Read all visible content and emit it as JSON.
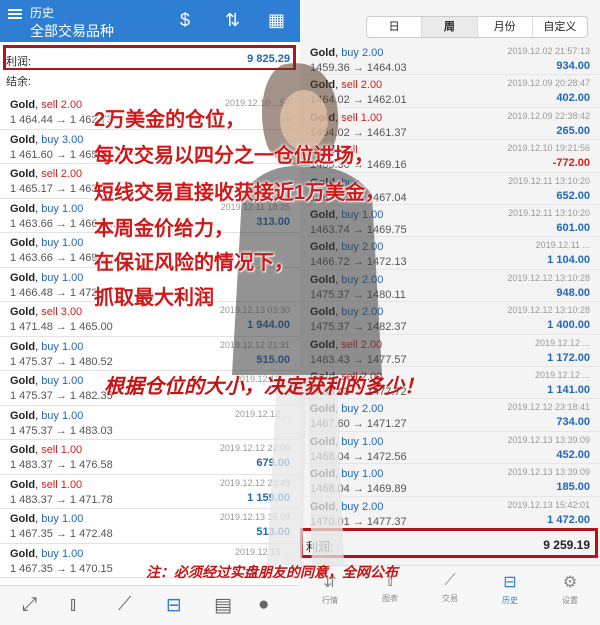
{
  "left": {
    "header": {
      "title": "历史",
      "subtitle": "全部交易品种"
    },
    "summary": {
      "profit_label": "利润:",
      "profit_value": "9 825.29",
      "balance_label": "结余:"
    },
    "trades": [
      {
        "symbol": "Gold",
        "side": "sell",
        "lots": "2.00",
        "prices": "1 464.44 → 1 462.73",
        "datetime": "2019.12.10 ...52",
        "profit": "..."
      },
      {
        "symbol": "Gold",
        "side": "buy",
        "lots": "3.00",
        "prices": "1 461.60 → 1 465.1...",
        "datetime": "",
        "profit": ""
      },
      {
        "symbol": "Gold",
        "side": "sell",
        "lots": "2.00",
        "prices": "1 465.17 → 1 463.64",
        "datetime": "",
        "profit": ""
      },
      {
        "symbol": "Gold",
        "side": "buy",
        "lots": "1.00",
        "prices": "1 463.66 → 1 466.7...",
        "datetime": "2019.12.11 18:25",
        "profit": "313.00"
      },
      {
        "symbol": "Gold",
        "side": "buy",
        "lots": "1.00",
        "prices": "1 463.66 → 1 469.6...",
        "datetime": "",
        "profit": ""
      },
      {
        "symbol": "Gold",
        "side": "buy",
        "lots": "1.00",
        "prices": "1 466.48 → 1 472.00",
        "datetime": "",
        "profit": ""
      },
      {
        "symbol": "Gold",
        "side": "sell",
        "lots": "3.00",
        "prices": "1 471.48 → 1 465.00",
        "datetime": "2019.12.13 03:30",
        "profit": "1 944.00"
      },
      {
        "symbol": "Gold",
        "side": "buy",
        "lots": "1.00",
        "prices": "1 475.37 → 1 480.52",
        "datetime": "2019.12.12 21:31",
        "profit": "515.00"
      },
      {
        "symbol": "Gold",
        "side": "buy",
        "lots": "1.00",
        "prices": "1 475.37 → 1 482.35",
        "datetime": "2019.12.12 ...",
        "profit": ""
      },
      {
        "symbol": "Gold",
        "side": "buy",
        "lots": "1.00",
        "prices": "1 475.37 → 1 483.03",
        "datetime": "2019.12.12 ...",
        "profit": ""
      },
      {
        "symbol": "Gold",
        "side": "sell",
        "lots": "1.00",
        "prices": "1 483.37 → 1 476.58",
        "datetime": "2019.12.12 22:00",
        "profit": "679.00"
      },
      {
        "symbol": "Gold",
        "side": "sell",
        "lots": "1.00",
        "prices": "1 483.37 → 1 471.78",
        "datetime": "2019.12.12 23:49",
        "profit": "1 159.00"
      },
      {
        "symbol": "Gold",
        "side": "buy",
        "lots": "1.00",
        "prices": "1 467.35 → 1 472.48",
        "datetime": "2019.12.13 16:09",
        "profit": "513.00"
      },
      {
        "symbol": "Gold",
        "side": "buy",
        "lots": "1.00",
        "prices": "1 467.35 → 1 470.15",
        "datetime": "2019.12.13 ...",
        "profit": ""
      }
    ],
    "tabs": [
      {
        "icon": "trend-arrow-icon"
      },
      {
        "icon": "candlestick-icon"
      },
      {
        "icon": "chart-line-icon"
      },
      {
        "icon": "inbox-icon"
      },
      {
        "icon": "news-icon"
      },
      {
        "icon": "chat-icon"
      }
    ]
  },
  "right": {
    "periods": [
      "日",
      "周",
      "月份",
      "自定义"
    ],
    "active_period": "周",
    "trades": [
      {
        "symbol": "Gold",
        "side": "buy",
        "lots": "2.00",
        "prices": "1459.36 → 1464.03",
        "datetime": "2019.12.02 21:57:13",
        "profit": "934.00"
      },
      {
        "symbol": "Gold",
        "side": "sell",
        "lots": "2.00",
        "prices": "1464.02 → 1462.01",
        "datetime": "2019.12.09 20:28:47",
        "profit": "402.00"
      },
      {
        "symbol": "Gold",
        "side": "sell",
        "lots": "1.00",
        "prices": "1464.02 → 1461.37",
        "datetime": "2019.12.09 22:38:42",
        "profit": "265.00"
      },
      {
        "symbol": "Gold",
        "side": "sell",
        "lots": "",
        "prices": "1465.30 → 1469.16",
        "datetime": "2019.12.10 19:21:56",
        "profit": "-772.00"
      },
      {
        "symbol": "Gold",
        "side": "buy",
        "lots": "",
        "prices": "1463.78 → 1467.04",
        "datetime": "2019.12.11 13:10:20",
        "profit": "652.00"
      },
      {
        "symbol": "Gold",
        "side": "buy",
        "lots": "1.00",
        "prices": "1463.74 → 1469.75",
        "datetime": "2019.12.11 13:10:20",
        "profit": "601.00"
      },
      {
        "symbol": "Gold",
        "side": "buy",
        "lots": "2.00",
        "prices": "1466.72 → 1472.13",
        "datetime": "2019.12.11 ...",
        "profit": "1 104.00"
      },
      {
        "symbol": "Gold",
        "side": "buy",
        "lots": "2.00",
        "prices": "1475.37 → 1480.11",
        "datetime": "2019.12.12 13:10:28",
        "profit": "948.00"
      },
      {
        "symbol": "Gold",
        "side": "buy",
        "lots": "2.00",
        "prices": "1475.37 → 1482.37",
        "datetime": "2019.12.12 13:10:28",
        "profit": "1 400.00"
      },
      {
        "symbol": "Gold",
        "side": "sell",
        "lots": "2.00",
        "prices": "1483.43 → 1477.57",
        "datetime": "2019.12.12 ...",
        "profit": "1 172.00"
      },
      {
        "symbol": "Gold",
        "side": "sell",
        "lots": "2.00",
        "prices": "1483.43 → 1477.72",
        "datetime": "2019.12.12 ...",
        "profit": "1 141.00"
      },
      {
        "symbol": "Gold",
        "side": "buy",
        "lots": "2.00",
        "prices": "1467.60 → 1471.27",
        "datetime": "2019.12.12 23:18:41",
        "profit": "734.00"
      },
      {
        "symbol": "Gold",
        "side": "buy",
        "lots": "1.00",
        "prices": "1468.04 → 1472.56",
        "datetime": "2019.12.13 13:39:09",
        "profit": "452.00"
      },
      {
        "symbol": "Gold",
        "side": "buy",
        "lots": "1.00",
        "prices": "1468.04 → 1469.89",
        "datetime": "2019.12.13 13:39:09",
        "profit": "185.00"
      },
      {
        "symbol": "Gold",
        "side": "buy",
        "lots": "2.00",
        "prices": "1470.01 → 1477.37",
        "datetime": "2019.12.13 15:42:01",
        "profit": "1 472.00"
      }
    ],
    "summary": {
      "profit_label": "利润:",
      "profit_value": "9 259.19"
    },
    "tabs": [
      {
        "icon": "quotes-icon",
        "label": "行情"
      },
      {
        "icon": "chart-icon",
        "label": "图表"
      },
      {
        "icon": "trade-icon",
        "label": "交易"
      },
      {
        "icon": "history-icon",
        "label": "历史"
      },
      {
        "icon": "settings-icon",
        "label": "设置"
      }
    ]
  },
  "overlay": {
    "lines": [
      "2万美金的仓位，",
      "每次交易以四分之一仓位进场，",
      "短线交易直接收获接近1万美金，",
      "本周金价给力，",
      "在保证风险的情况下，",
      "抓取最大利润"
    ],
    "caption": "根据仓位的大小，决定获利的多少！",
    "note": "注：必须经过实盘朋友的同意，全网公布"
  },
  "colors": {
    "header_bg": "#2e7fd3",
    "sell": "#d32020",
    "buy": "#2367b8",
    "highlight_box": "#b3141b",
    "overlay_text": "#d01818"
  }
}
